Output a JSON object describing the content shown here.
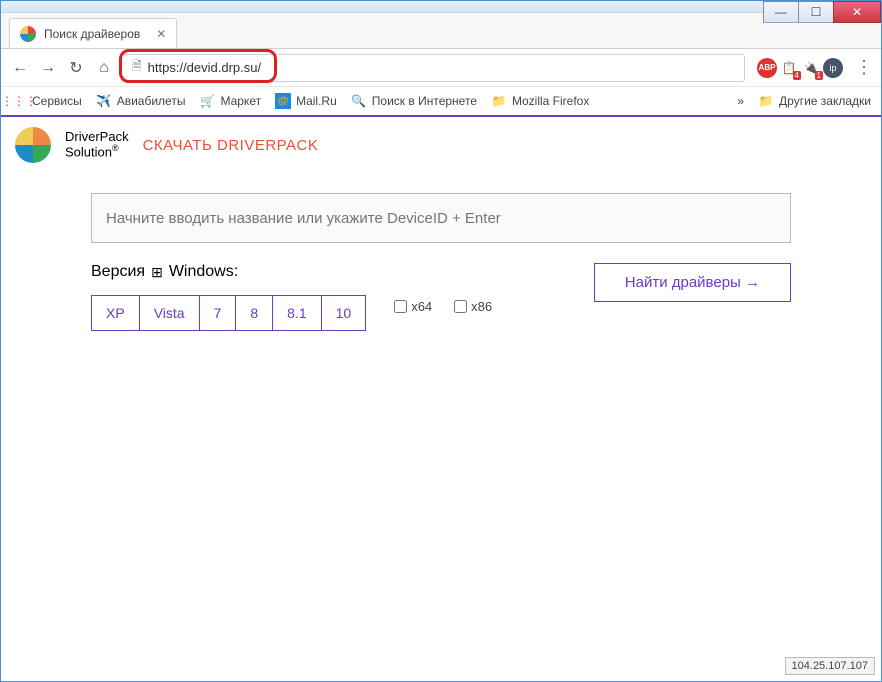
{
  "window": {
    "minimize": "—",
    "maximize": "☐",
    "close": "✕"
  },
  "tab": {
    "title": "Поиск драйверов",
    "close": "✕"
  },
  "nav": {
    "back": "←",
    "forward": "→",
    "reload": "↻",
    "home": "⌂",
    "url": "https://devid.drp.su/",
    "menu": "⋮"
  },
  "extensions": {
    "abp": "ABP",
    "ext2": "4",
    "ext3": "1",
    "ip": "ip"
  },
  "bookmarks": {
    "apps": "Сервисы",
    "avia": "Авиабилеты",
    "market": "Маркет",
    "mailru": "Mail.Ru",
    "search": "Поиск в Интернете",
    "firefox": "Mozilla Firefox",
    "more": "»",
    "other": "Другие закладки"
  },
  "brand": {
    "line1": "DriverPack",
    "line2": "Solution",
    "download": "СКАЧАТЬ DRIVERPACK"
  },
  "search": {
    "placeholder": "Начните вводить название или укажите DeviceID + Enter"
  },
  "version": {
    "label_prefix": "Версия",
    "label_os": "Windows:",
    "options": [
      "XP",
      "Vista",
      "7",
      "8",
      "8.1",
      "10"
    ],
    "arch64": "x64",
    "arch86": "x86"
  },
  "find_button": "Найти драйверы →",
  "status_ip": "104.25.107.107"
}
